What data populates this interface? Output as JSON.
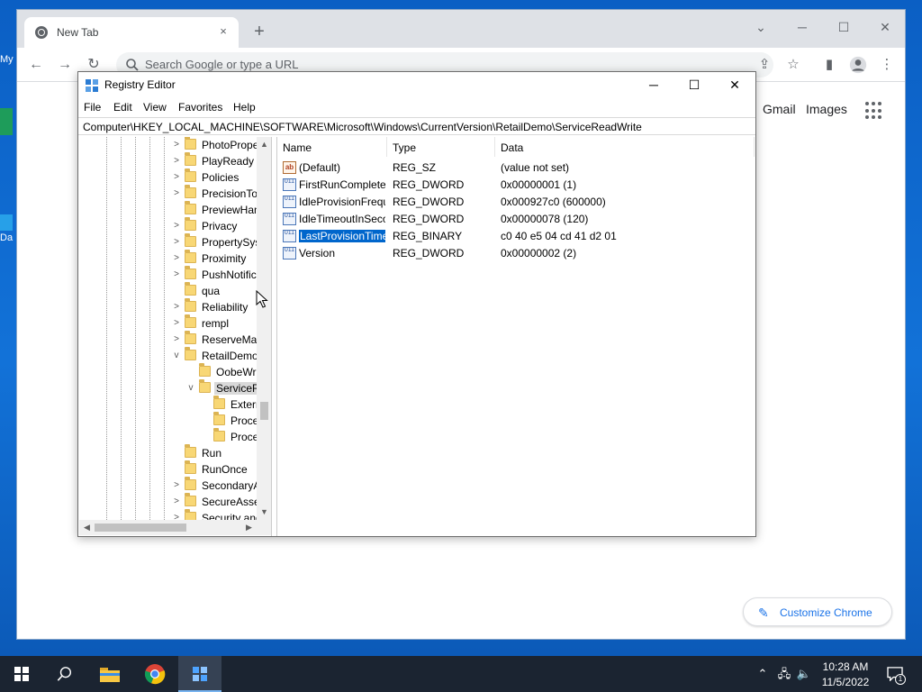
{
  "desktop": {
    "icons": [
      {
        "label": "My"
      },
      {
        "label": "Da"
      }
    ]
  },
  "chrome": {
    "tab_title": "New Tab",
    "tab_close": "×",
    "new_tab": "+",
    "omnibox_placeholder": "Search Google or type a URL",
    "links": {
      "gmail": "Gmail",
      "images": "Images"
    },
    "customize_label": "Customize Chrome"
  },
  "regedit": {
    "title": "Registry Editor",
    "menu": [
      "File",
      "Edit",
      "View",
      "Favorites",
      "Help"
    ],
    "address": "Computer\\HKEY_LOCAL_MACHINE\\SOFTWARE\\Microsoft\\Windows\\CurrentVersion\\RetailDemo\\ServiceReadWrite",
    "tree": [
      {
        "label": "PhotoPropertyHandler",
        "expander": ">"
      },
      {
        "label": "PlayReady",
        "expander": ">"
      },
      {
        "label": "Policies",
        "expander": ">"
      },
      {
        "label": "PrecisionTouchPad",
        "expander": ">"
      },
      {
        "label": "PreviewHandlers",
        "expander": ""
      },
      {
        "label": "Privacy",
        "expander": ">"
      },
      {
        "label": "PropertySystem",
        "expander": ">"
      },
      {
        "label": "Proximity",
        "expander": ">"
      },
      {
        "label": "PushNotifications",
        "expander": ">"
      },
      {
        "label": "qua",
        "expander": ""
      },
      {
        "label": "Reliability",
        "expander": ">"
      },
      {
        "label": "rempl",
        "expander": ">"
      },
      {
        "label": "ReserveManager",
        "expander": ">"
      },
      {
        "label": "RetailDemo",
        "expander": "v"
      },
      {
        "label": "OobeWrite",
        "expander": ""
      },
      {
        "label": "ServiceReadWrite",
        "expander": "v"
      },
      {
        "label": "External",
        "expander": ""
      },
      {
        "label": "ProcessList",
        "expander": ""
      },
      {
        "label": "ProcessWatch",
        "expander": ""
      },
      {
        "label": "Run",
        "expander": ""
      },
      {
        "label": "RunOnce",
        "expander": ""
      },
      {
        "label": "SecondaryAuthFactor",
        "expander": ">"
      },
      {
        "label": "SecureAssessment",
        "expander": ">"
      },
      {
        "label": "Security and Maintenance",
        "expander": ">"
      }
    ],
    "columns": {
      "name": "Name",
      "type": "Type",
      "data": "Data"
    },
    "values": [
      {
        "name": "(Default)",
        "type": "REG_SZ",
        "data": "(value not set)",
        "icon": "ab"
      },
      {
        "name": "FirstRunCompleted",
        "type": "REG_DWORD",
        "data": "0x00000001 (1)",
        "icon": "011"
      },
      {
        "name": "IdleProvisionFrequency",
        "type": "REG_DWORD",
        "data": "0x000927c0 (600000)",
        "icon": "011"
      },
      {
        "name": "IdleTimeoutInSeconds",
        "type": "REG_DWORD",
        "data": "0x00000078 (120)",
        "icon": "011"
      },
      {
        "name": "LastProvisionTime",
        "type": "REG_BINARY",
        "data": "c0 40 e5 04 cd 41 d2 01",
        "icon": "011"
      },
      {
        "name": "Version",
        "type": "REG_DWORD",
        "data": "0x00000002 (2)",
        "icon": "011"
      }
    ]
  },
  "taskbar": {
    "time": "10:28 AM",
    "date": "11/5/2022",
    "notification_count": "1"
  },
  "colors": {
    "selection": "#0066cc",
    "folder": "#f8d775",
    "taskbar": "#1b2431"
  }
}
